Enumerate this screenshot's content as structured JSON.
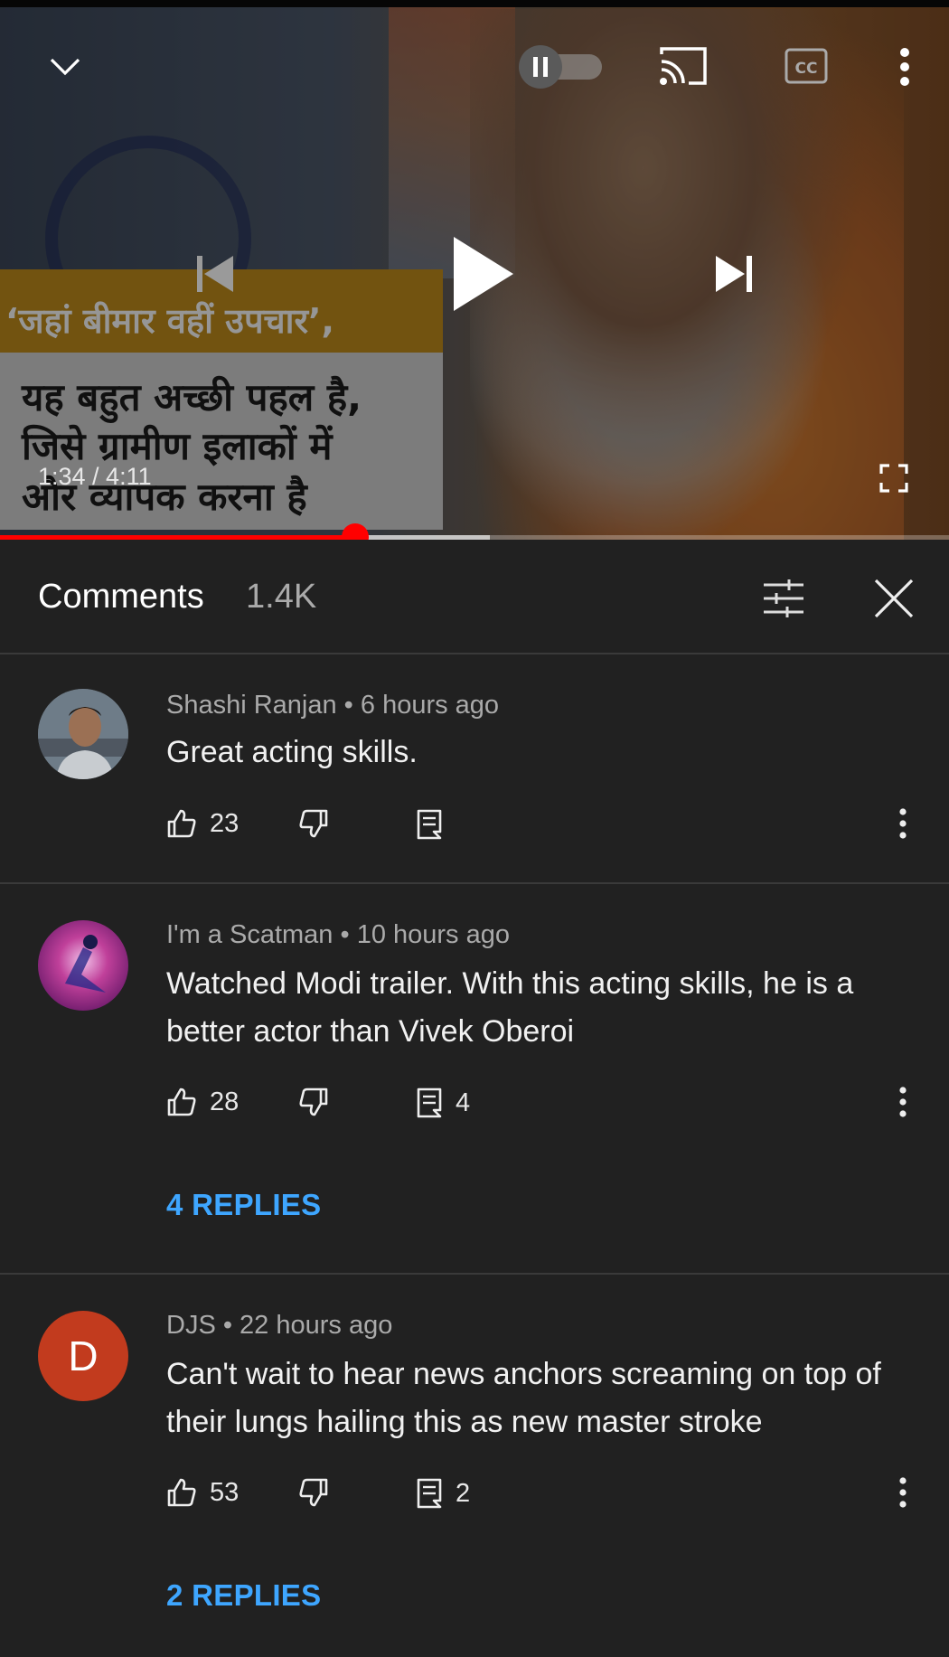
{
  "player": {
    "overlay_text": [
      "‘जहां बीमार वहीं उपचार’,",
      "यह बहुत अच्छी पहल है,",
      "जिसे ग्रामीण इलाकों में",
      "और व्यापक करना है"
    ],
    "time": "1:34 / 4:11",
    "progress": 0.374,
    "buffered": 0.516,
    "icons": [
      "chevron-down-icon",
      "pause-toggle-icon",
      "cast-icon",
      "captions-icon",
      "more-vert-icon",
      "previous-icon",
      "play-icon",
      "next-icon",
      "fullscreen-icon"
    ],
    "accent_color": "#ff0000"
  },
  "comments_panel": {
    "title": "Comments",
    "count": "1.4K"
  },
  "comments": [
    {
      "author": "Shashi Ranjan",
      "time": "6 hours ago",
      "meta": "Shashi Ranjan • 6 hours ago",
      "text": "Great acting skills.",
      "likes": "23",
      "replies_count": "",
      "replies_label": ""
    },
    {
      "author": "I'm a Scatman",
      "time": "10 hours ago",
      "meta": "I'm a Scatman • 10 hours ago",
      "text": "Watched Modi trailer. With this acting skills, he is a better actor than Vivek Oberoi",
      "likes": "28",
      "replies_count": "4",
      "replies_label": "4 REPLIES"
    },
    {
      "author": "DJS",
      "time": "22 hours ago",
      "meta": "DJS • 22 hours ago",
      "text": "Can't wait to hear news anchors screaming on top of their lungs hailing this as new master stroke",
      "likes": "53",
      "replies_count": "2",
      "replies_label": "2 REPLIES",
      "avatar_letter": "D",
      "avatar_color": "#c23b1e"
    }
  ],
  "colors": {
    "background": "#212121",
    "link": "#3ea6ff",
    "secondary_text": "#aaaaaa"
  }
}
